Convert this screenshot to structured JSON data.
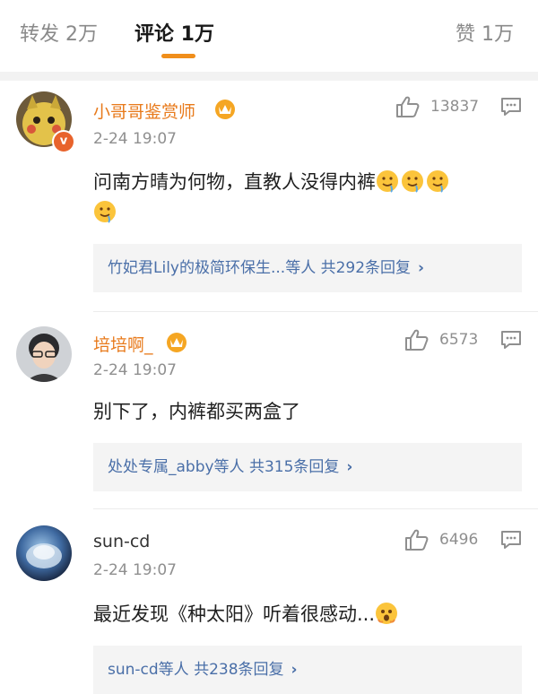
{
  "tabs": [
    {
      "label": "转发 2万"
    },
    {
      "label": "评论 1万"
    },
    {
      "label": "赞 1万"
    }
  ],
  "colors": {
    "accent": "#f08e1b",
    "username": "#e87a1b",
    "link": "#4a6fa8",
    "muted": "#8f8f8f"
  },
  "comments": [
    {
      "username": "小哥哥鉴赏师",
      "time": "2-24 19:07",
      "likes": "13837",
      "text": "问南方晴为何物，直教人没得内裤",
      "emoji": "drooling-face",
      "reply_summary": "竹妃君Lily的极简环保生...等人 共292条回复",
      "verified": true,
      "crown": true
    },
    {
      "username": "培培啊_",
      "time": "2-24 19:07",
      "likes": "6573",
      "text": "别下了，内裤都买两盒了",
      "reply_summary": "处处专属_abby等人 共315条回复",
      "crown": true
    },
    {
      "username": "sun-cd",
      "time": "2-24 19:07",
      "likes": "6496",
      "text": "最近发现《种太阳》听着很感动...",
      "emoji": "fearful-face",
      "reply_summary": "sun-cd等人 共238条回复"
    }
  ],
  "icons": {
    "like": "thumbs-up-icon",
    "comment": "comment-icon",
    "chevron": "›",
    "crown": "crown-icon"
  }
}
